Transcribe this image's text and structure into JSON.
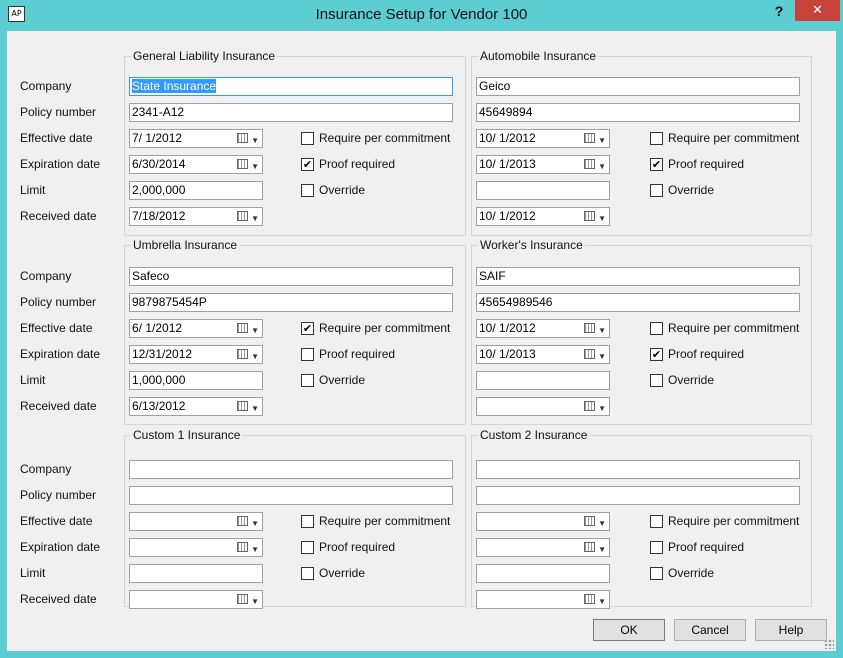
{
  "window": {
    "title": "Insurance Setup for Vendor 100",
    "help": "?",
    "close": "✕",
    "app_icon": "AP"
  },
  "labels": {
    "company": "Company",
    "policy_number": "Policy number",
    "effective_date": "Effective date",
    "expiration_date": "Expiration date",
    "limit": "Limit",
    "received_date": "Received date"
  },
  "check_labels": {
    "require": "Require per commitment",
    "proof": "Proof required",
    "override": "Override"
  },
  "groups": {
    "general": {
      "title": "General Liability Insurance",
      "company": "State Insurance",
      "policy": "2341-A12",
      "effective": "7/ 1/2012",
      "expiration": "6/30/2014",
      "limit": "2,000,000",
      "received": "7/18/2012",
      "require": false,
      "proof": true,
      "override": false
    },
    "auto": {
      "title": "Automobile Insurance",
      "company": "Geico",
      "policy": "45649894",
      "effective": "10/ 1/2012",
      "expiration": "10/ 1/2013",
      "limit": "",
      "received": "10/ 1/2012",
      "require": false,
      "proof": true,
      "override": false
    },
    "umbrella": {
      "title": "Umbrella Insurance",
      "company": "Safeco",
      "policy": "9879875454P",
      "effective": "6/ 1/2012",
      "expiration": "12/31/2012",
      "limit": "1,000,000",
      "received": "6/13/2012",
      "require": true,
      "proof": false,
      "override": false
    },
    "workers": {
      "title": "Worker's Insurance",
      "company": "SAIF",
      "policy": "45654989546",
      "effective": "10/ 1/2012",
      "expiration": "10/ 1/2013",
      "limit": "",
      "received": "",
      "require": false,
      "proof": true,
      "override": false
    },
    "custom1": {
      "title": "Custom 1 Insurance",
      "company": "",
      "policy": "",
      "effective": "",
      "expiration": "",
      "limit": "",
      "received": "",
      "require": false,
      "proof": false,
      "override": false
    },
    "custom2": {
      "title": "Custom 2 Insurance",
      "company": "",
      "policy": "",
      "effective": "",
      "expiration": "",
      "limit": "",
      "received": "",
      "require": false,
      "proof": false,
      "override": false
    }
  },
  "buttons": {
    "ok": "OK",
    "cancel": "Cancel",
    "help": "Help"
  }
}
